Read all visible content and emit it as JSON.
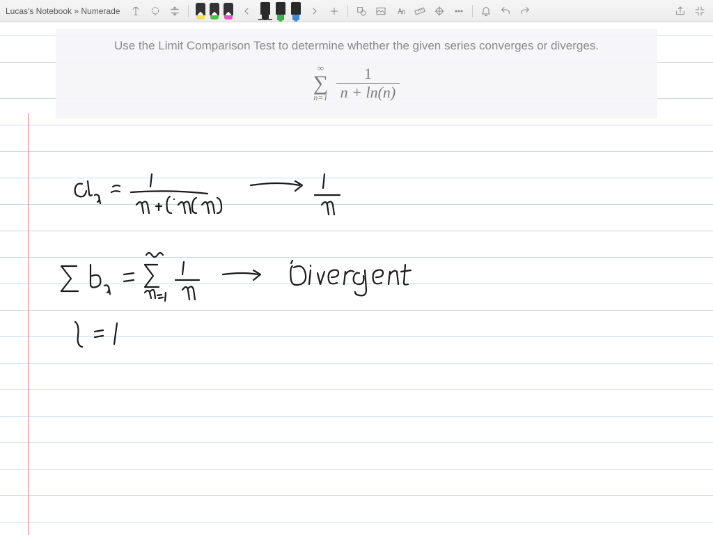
{
  "breadcrumb": {
    "notebook": "Lucas's Notebook",
    "sep": "»",
    "page": "Numerade"
  },
  "toolbar": {
    "highlighters": [
      {
        "body": "#333",
        "tip": "#f5e050"
      },
      {
        "body": "#333",
        "tip": "#4ac24a"
      },
      {
        "body": "#333",
        "tip": "#e056c0"
      }
    ],
    "markers": [
      {
        "tip": "#2a2a2a",
        "selected": true
      },
      {
        "tip": "#3cb04a"
      },
      {
        "tip": "#3a8ad8"
      }
    ]
  },
  "question": {
    "text": "Use the Limit Comparison Test to determine whether the given series converges or diverges.",
    "sum_top": "∞",
    "sum_bot": "n=1",
    "frac_top": "1",
    "frac_bot": "n + ln(n)"
  },
  "handwriting_description": {
    "line1": "a_n = 1 / (n + ln(n))  →  1/n",
    "line2": "Σ b_n = Σ_{n=1}^∞ 1/n  →  divergent",
    "line3": "l = 1"
  }
}
